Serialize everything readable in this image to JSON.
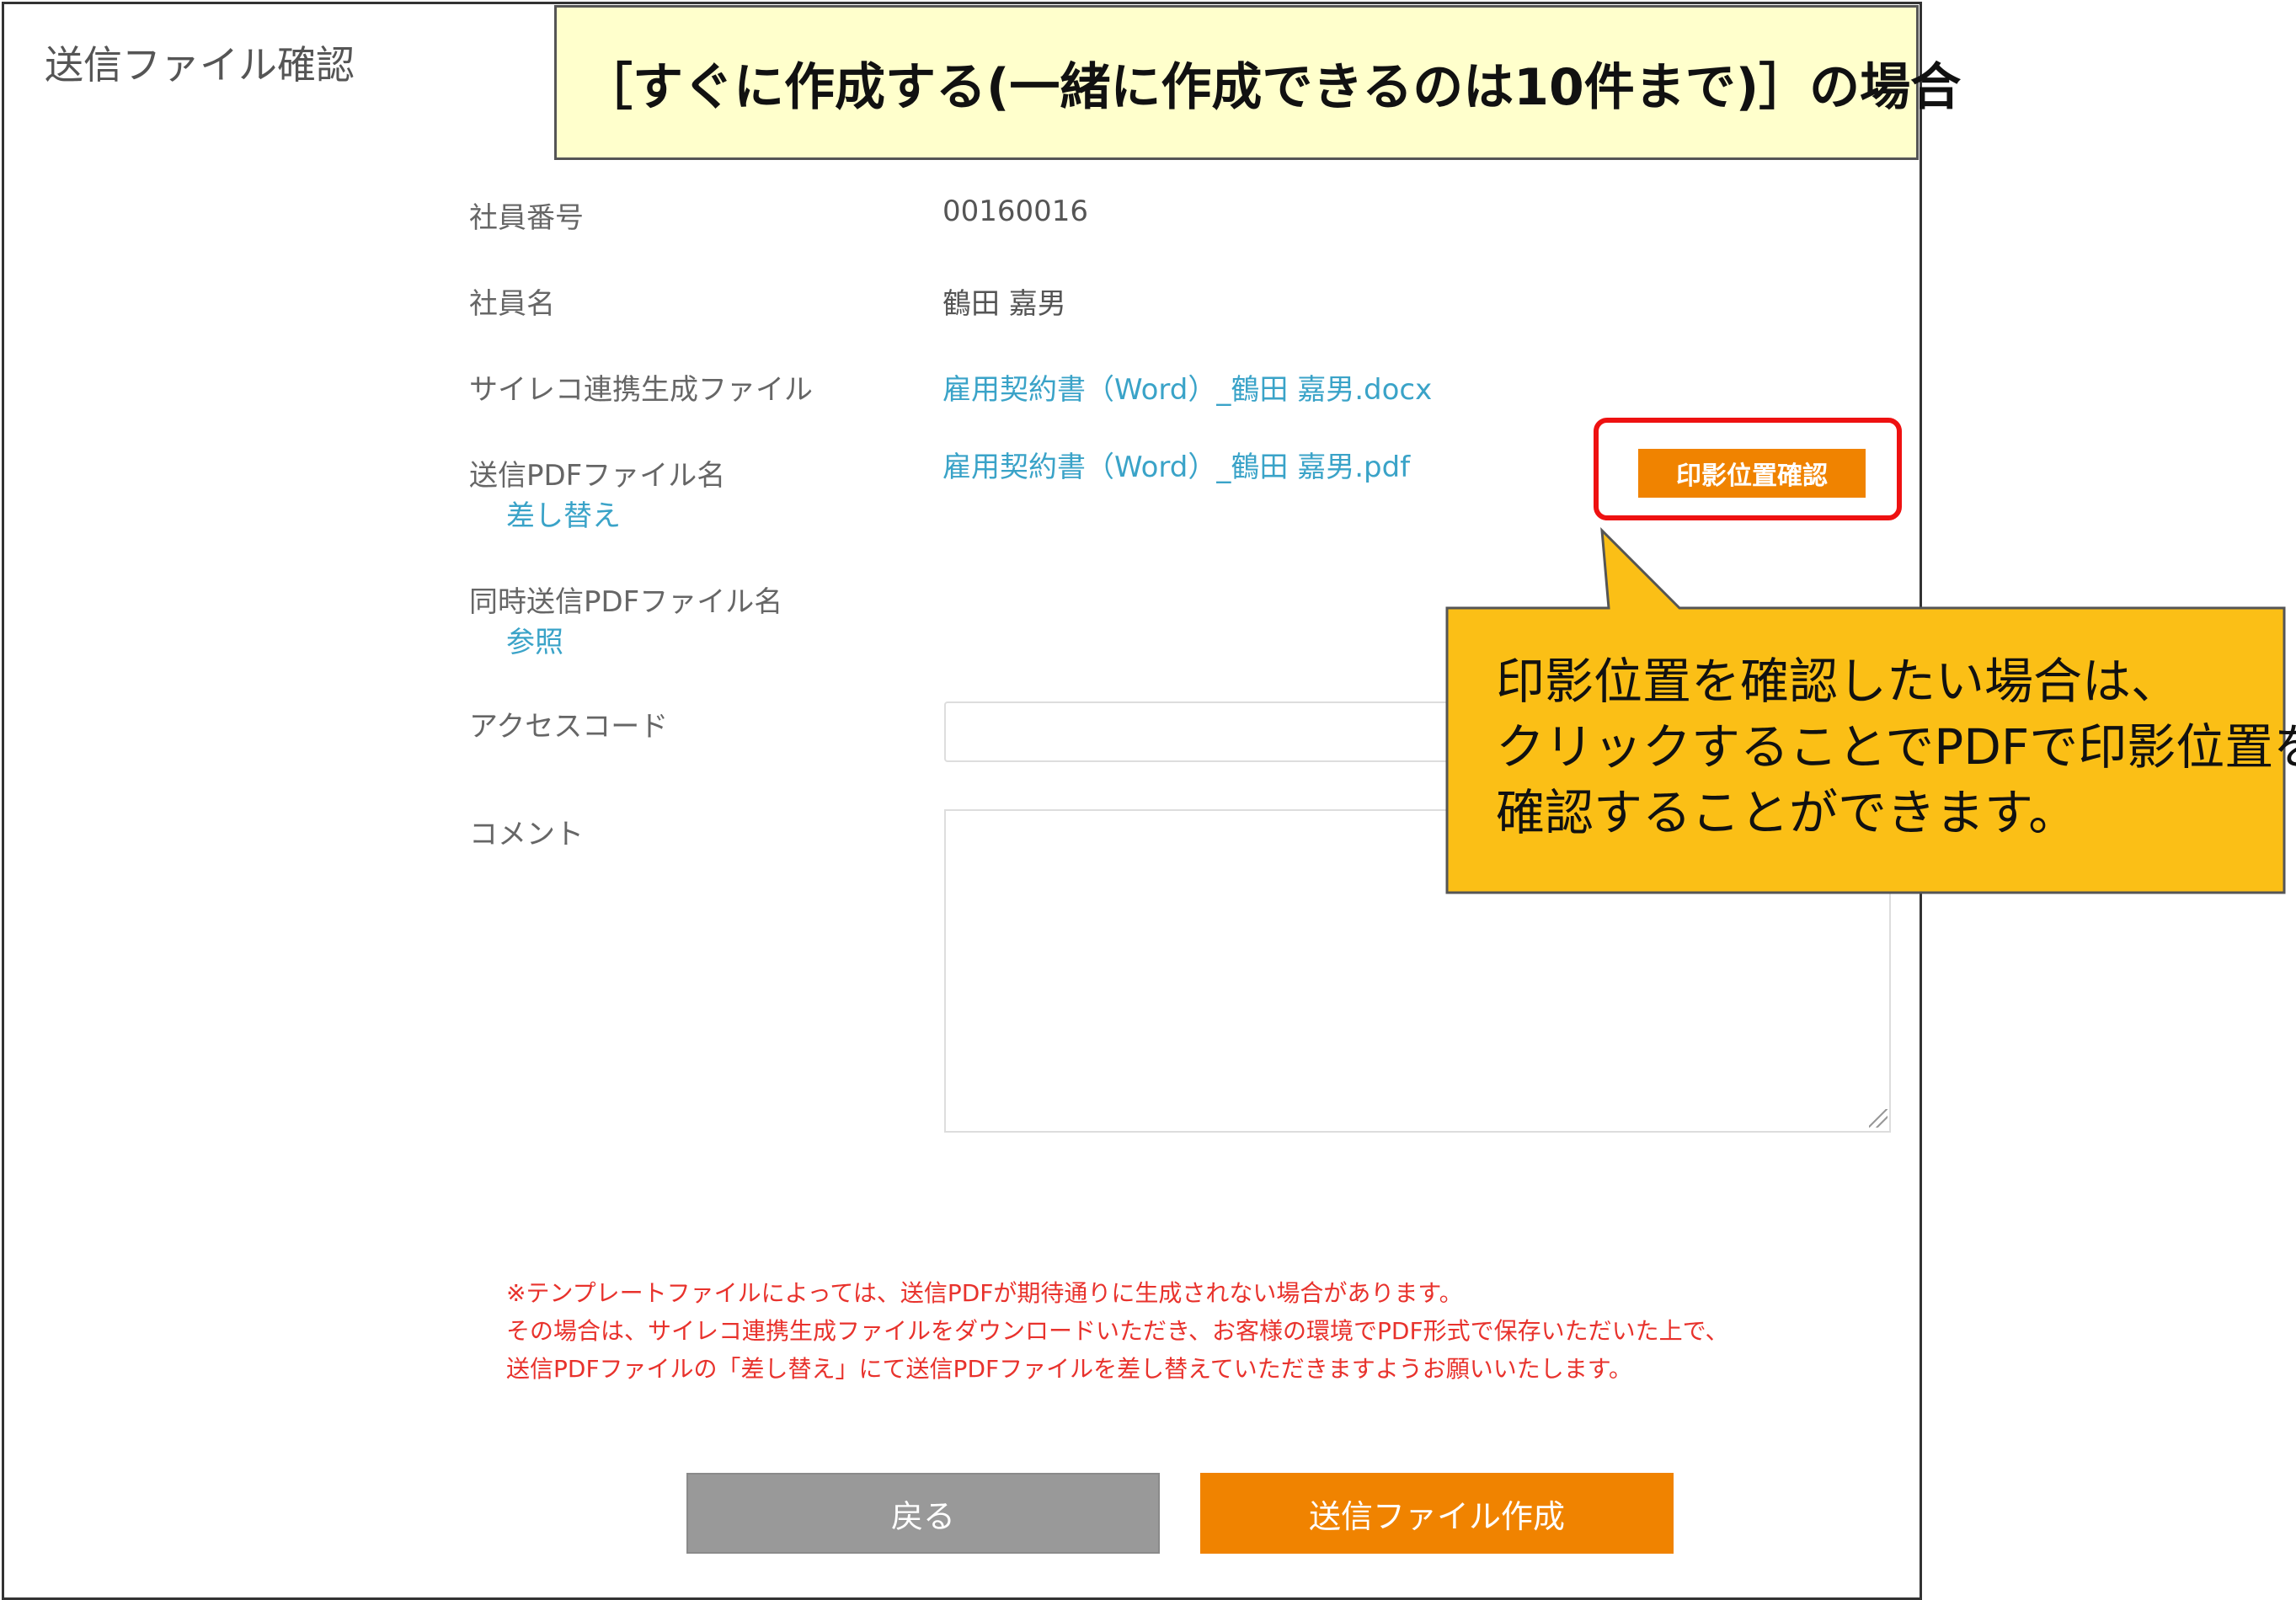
{
  "dialog": {
    "title": "送信ファイル確認"
  },
  "banner": {
    "text": "［すぐに作成する(一緒に作成できるのは10件まで)］の場合"
  },
  "form": {
    "employee_number_label": "社員番号",
    "employee_number_value": "00160016",
    "employee_name_label": "社員名",
    "employee_name_value": "鶴田 嘉男",
    "generated_file_label": "サイレコ連携生成ファイル",
    "generated_file_link": "雇用契約書（Word）_鶴田 嘉男.docx",
    "pdf_file_label": "送信PDFファイル名",
    "pdf_replace_link": "差し替え",
    "pdf_file_link": "雇用契約書（Word）_鶴田 嘉男.pdf",
    "stamp_check_button": "印影位置確認",
    "simultaneous_pdf_label": "同時送信PDFファイル名",
    "browse_link": "参照",
    "access_code_label": "アクセスコード",
    "access_code_value": "",
    "comment_label": "コメント",
    "comment_value": ""
  },
  "notice": {
    "line1": "※テンプレートファイルによっては、送信PDFが期待通りに生成されない場合があります。",
    "line2": "その場合は、サイレコ連携生成ファイルをダウンロードいただき、お客様の環境でPDF形式で保存いただいた上で、",
    "line3": "送信PDFファイルの「差し替え」にて送信PDFファイルを差し替えていただきますようお願いいたします。"
  },
  "buttons": {
    "back": "戻る",
    "create": "送信ファイル作成"
  },
  "callout": {
    "line1": "印影位置を確認したい場合は、",
    "line2": "クリックすることでPDFで印影位置を",
    "line3": "確認することができます。"
  },
  "colors": {
    "accent_orange": "#f08300",
    "link_blue": "#3aa3c8",
    "notice_red": "#e8322c",
    "highlight_red": "#ee1111",
    "callout_yellow": "#fbbf16",
    "banner_yellow": "#ffffcc"
  }
}
